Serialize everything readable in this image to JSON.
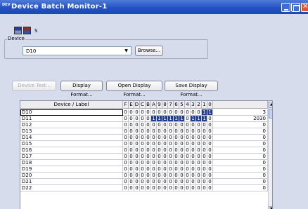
{
  "window": {
    "title": "Device Batch Monitor-1",
    "app_icon_text": "DEV"
  },
  "toolbar": {
    "status_label": "S"
  },
  "device_group": {
    "legend": "Device",
    "selected": "D10",
    "browse_label": "Browse..."
  },
  "buttons": {
    "device_test": "Device Test...",
    "display_format": "Display Format...",
    "open_display_format": "Open Display Format...",
    "save_display_format": "Save Display Format..."
  },
  "table": {
    "label_header": "Device / Label",
    "bit_headers": [
      "F",
      "E",
      "D",
      "C",
      "B",
      "A",
      "9",
      "8",
      "7",
      "6",
      "5",
      "4",
      "3",
      "2",
      "1",
      "0"
    ],
    "rows": [
      {
        "label": "D10",
        "bits": [
          0,
          0,
          0,
          0,
          0,
          0,
          0,
          0,
          0,
          0,
          0,
          0,
          0,
          0,
          1,
          1
        ],
        "value": "3"
      },
      {
        "label": "D11",
        "bits": [
          0,
          0,
          0,
          0,
          0,
          1,
          1,
          1,
          1,
          1,
          1,
          0,
          1,
          1,
          1,
          0
        ],
        "value": "2030"
      },
      {
        "label": "D12",
        "bits": [
          0,
          0,
          0,
          0,
          0,
          0,
          0,
          0,
          0,
          0,
          0,
          0,
          0,
          0,
          0,
          0
        ],
        "value": "0"
      },
      {
        "label": "D13",
        "bits": [
          0,
          0,
          0,
          0,
          0,
          0,
          0,
          0,
          0,
          0,
          0,
          0,
          0,
          0,
          0,
          0
        ],
        "value": "0"
      },
      {
        "label": "D14",
        "bits": [
          0,
          0,
          0,
          0,
          0,
          0,
          0,
          0,
          0,
          0,
          0,
          0,
          0,
          0,
          0,
          0
        ],
        "value": "0"
      },
      {
        "label": "D15",
        "bits": [
          0,
          0,
          0,
          0,
          0,
          0,
          0,
          0,
          0,
          0,
          0,
          0,
          0,
          0,
          0,
          0
        ],
        "value": "0"
      },
      {
        "label": "D16",
        "bits": [
          0,
          0,
          0,
          0,
          0,
          0,
          0,
          0,
          0,
          0,
          0,
          0,
          0,
          0,
          0,
          0
        ],
        "value": "0"
      },
      {
        "label": "D17",
        "bits": [
          0,
          0,
          0,
          0,
          0,
          0,
          0,
          0,
          0,
          0,
          0,
          0,
          0,
          0,
          0,
          0
        ],
        "value": "0"
      },
      {
        "label": "D18",
        "bits": [
          0,
          0,
          0,
          0,
          0,
          0,
          0,
          0,
          0,
          0,
          0,
          0,
          0,
          0,
          0,
          0
        ],
        "value": "0"
      },
      {
        "label": "D19",
        "bits": [
          0,
          0,
          0,
          0,
          0,
          0,
          0,
          0,
          0,
          0,
          0,
          0,
          0,
          0,
          0,
          0
        ],
        "value": "0"
      },
      {
        "label": "D20",
        "bits": [
          0,
          0,
          0,
          0,
          0,
          0,
          0,
          0,
          0,
          0,
          0,
          0,
          0,
          0,
          0,
          0
        ],
        "value": "0"
      },
      {
        "label": "D21",
        "bits": [
          0,
          0,
          0,
          0,
          0,
          0,
          0,
          0,
          0,
          0,
          0,
          0,
          0,
          0,
          0,
          0
        ],
        "value": "0"
      },
      {
        "label": "D22",
        "bits": [
          0,
          0,
          0,
          0,
          0,
          0,
          0,
          0,
          0,
          0,
          0,
          0,
          0,
          0,
          0,
          0
        ],
        "value": "0"
      }
    ]
  },
  "colors": {
    "bit_on": "#1c3f9c",
    "titlebar": "#2452c4",
    "window_bg": "#d7dcec"
  },
  "icons": [
    "app-icon",
    "minimize-icon",
    "maximize-icon",
    "close-icon",
    "monitor-start-icon",
    "monitor-stop-icon",
    "dropdown-arrow-icon",
    "scroll-up-icon",
    "scroll-down-icon"
  ]
}
